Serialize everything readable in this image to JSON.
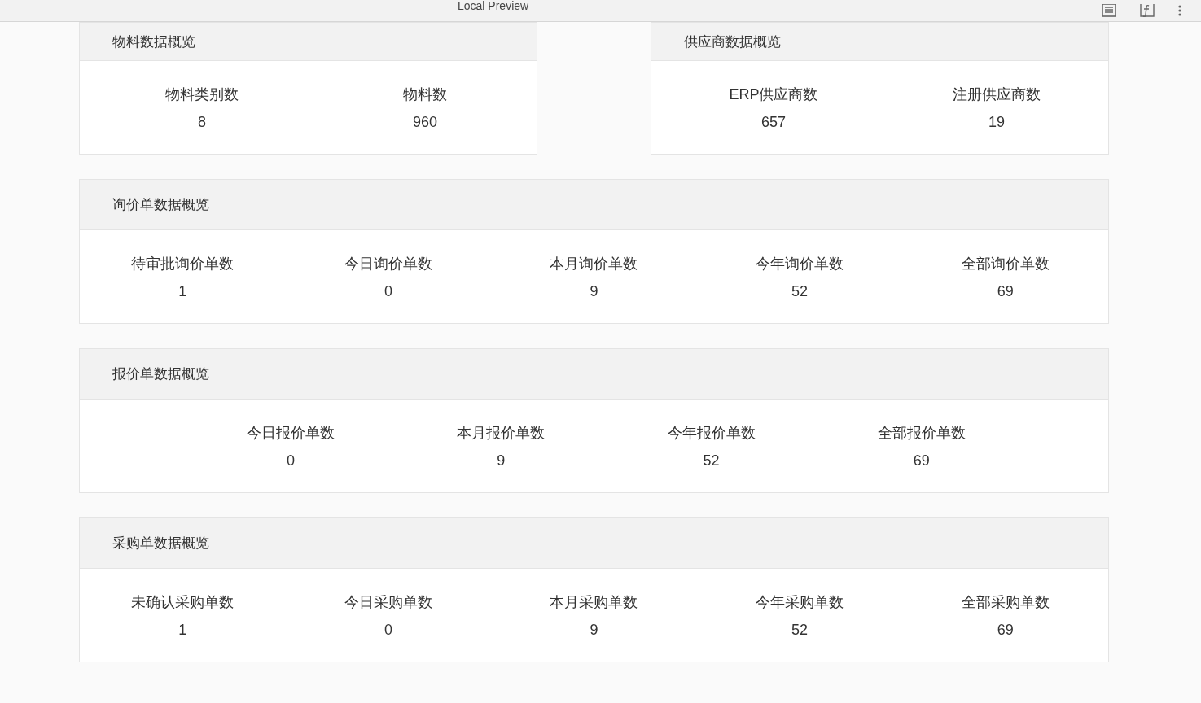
{
  "window": {
    "title": "Local Preview"
  },
  "top_cards": [
    {
      "title": "物料数据概览",
      "stats": [
        {
          "label": "物料类别数",
          "value": "8"
        },
        {
          "label": "物料数",
          "value": "960"
        }
      ]
    },
    {
      "title": "供应商数据概览",
      "stats": [
        {
          "label": "ERP供应商数",
          "value": "657"
        },
        {
          "label": "注册供应商数",
          "value": "19"
        }
      ]
    }
  ],
  "cards": [
    {
      "title": "询价单数据概览",
      "kind": "spread",
      "stats": [
        {
          "label": "待审批询价单数",
          "value": "1"
        },
        {
          "label": "今日询价单数",
          "value": "0"
        },
        {
          "label": "本月询价单数",
          "value": "9"
        },
        {
          "label": "今年询价单数",
          "value": "52"
        },
        {
          "label": "全部询价单数",
          "value": "69"
        }
      ]
    },
    {
      "title": "报价单数据概览",
      "kind": "centered",
      "stats": [
        {
          "label": "今日报价单数",
          "value": "0"
        },
        {
          "label": "本月报价单数",
          "value": "9"
        },
        {
          "label": "今年报价单数",
          "value": "52"
        },
        {
          "label": "全部报价单数",
          "value": "69"
        }
      ]
    },
    {
      "title": "采购单数据概览",
      "kind": "spread",
      "stats": [
        {
          "label": "未确认采购单数",
          "value": "1"
        },
        {
          "label": "今日采购单数",
          "value": "0"
        },
        {
          "label": "本月采购单数",
          "value": "9"
        },
        {
          "label": "今年采购单数",
          "value": "52"
        },
        {
          "label": "全部采购单数",
          "value": "69"
        }
      ]
    }
  ]
}
